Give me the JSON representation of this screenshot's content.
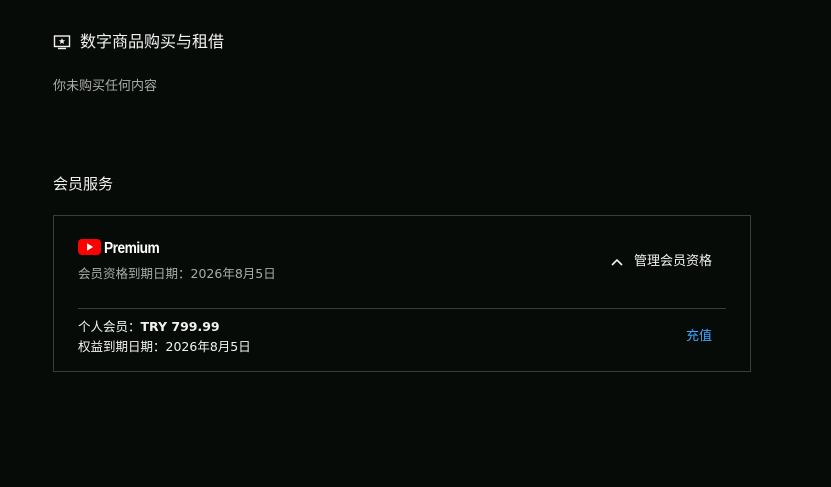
{
  "digital_purchases": {
    "title": "数字商品购买与租借",
    "icon": "movie-icon",
    "empty_text": "你未购买任何内容"
  },
  "memberships": {
    "title": "会员服务",
    "card": {
      "logo_word": "Premium",
      "logo_color": "#ff0000",
      "expiry_label": "会员资格到期日期：",
      "expiry_date": "2026年8月5日",
      "manage_label": "管理会员资格",
      "plan_label": "个人会员：",
      "plan_price": "TRY 799.99",
      "benefit_label": "权益到期日期：",
      "benefit_date": "2026年8月5日",
      "recharge_label": "充值",
      "link_color": "#3ea6ff"
    }
  }
}
